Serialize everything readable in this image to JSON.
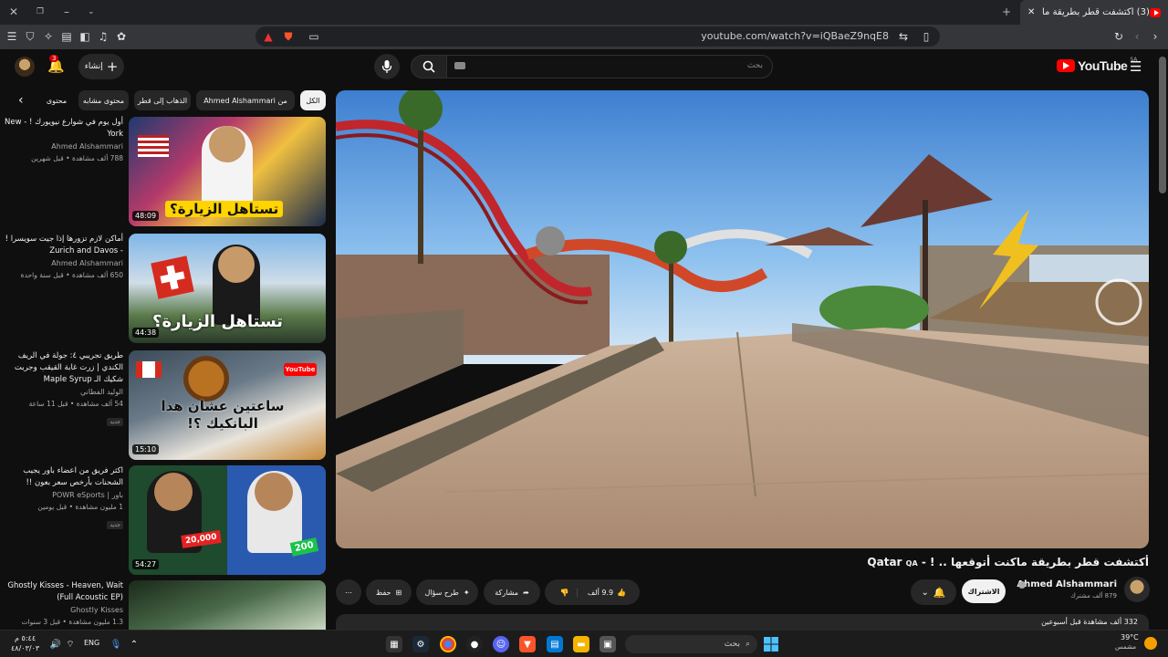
{
  "browser": {
    "tab_title": "(3) أكتشفت قطر بطريقة ماكنت",
    "url": "youtube.com/watch?v=iQBaeZ9nqE8"
  },
  "youtube": {
    "logo_text": "YouTube",
    "region": "SA",
    "search_placeholder": "بحث",
    "create_label": "إنشاء",
    "notifications_count": "3"
  },
  "chips": [
    "الكل",
    "من Ahmed Alshammari",
    "الذهاب إلى قطر",
    "محتوى مشابه",
    "محتوى"
  ],
  "recommendations": [
    {
      "title": "أول يوم في شوارع نيويورك ! - New York",
      "suffix": "US",
      "channel": "Ahmed Alshammari",
      "views": "788 ألف مشاهدة",
      "age": "قبل شهرين",
      "duration": "48:09",
      "thumb_text": "تستاهل الزيارة؟",
      "new": ""
    },
    {
      "title": "أماكن لازم تزورها إذا جيت سويسرا ! - Zurich and Davos",
      "suffix": "CH",
      "channel": "Ahmed Alshammari",
      "views": "650 ألف مشاهدة",
      "age": "قبل سنة واحدة",
      "duration": "44:38",
      "thumb_text": "تستاهل الزيارة؟",
      "new": ""
    },
    {
      "title": "طريق تجريبي ٤: جولة في الريف الكندي | زرت غابة القيقب وجربت شكيك الـ Maple Syrup",
      "suffix": "",
      "channel": "الوليد الفطاني",
      "views": "54 ألف مشاهدة",
      "age": "قبل 11 ساعة",
      "duration": "15:10",
      "thumb_text": "ساعتين عشان هذا البانكيك ؟!",
      "new": "جديد"
    },
    {
      "title": "اكثر فريق من اعضاء باور يجيب الشحنات بأرخص سعر بعون !!",
      "suffix": "",
      "channel": "باور | POWR eSports",
      "views": "1 مليون مشاهدة",
      "age": "قبل يومين",
      "duration": "54:27",
      "thumb_text": "",
      "new": "جديد",
      "price1": "20,000",
      "price2": "200"
    },
    {
      "title": "Ghostly Kisses - Heaven, Wait (Full Acoustic EP)",
      "suffix": "",
      "channel": "Ghostly Kisses",
      "views": "1.3 مليون مشاهدة",
      "age": "قبل 3 سنوات",
      "duration": "",
      "thumb_text": "",
      "new": ""
    }
  ],
  "video": {
    "title": "أكتشفت قطر بطريقة ماكنت أتوقعها .. ! - Qatar",
    "title_suffix": "QA",
    "channel": "Ahmed Alshammari",
    "subscribers": "879 ألف مشترك",
    "subscribe_label": "الاشتراك",
    "likes": "9.9 ألف",
    "share_label": "مشاركة",
    "ask_label": "طرح سؤال",
    "save_label": "حفظ",
    "views_line": "332 ألف مشاهدة قبل أسبوعين"
  },
  "taskbar": {
    "search_label": "بحث",
    "time": "٥:٤٤ م",
    "date": "٤٨/٠٣/٠٣",
    "lang": "ENG",
    "weather_temp": "39°C",
    "weather_desc": "مشمس"
  },
  "colors": {
    "background": "#0f0f0f",
    "accent": "#ff0000",
    "chip": "#272727"
  }
}
